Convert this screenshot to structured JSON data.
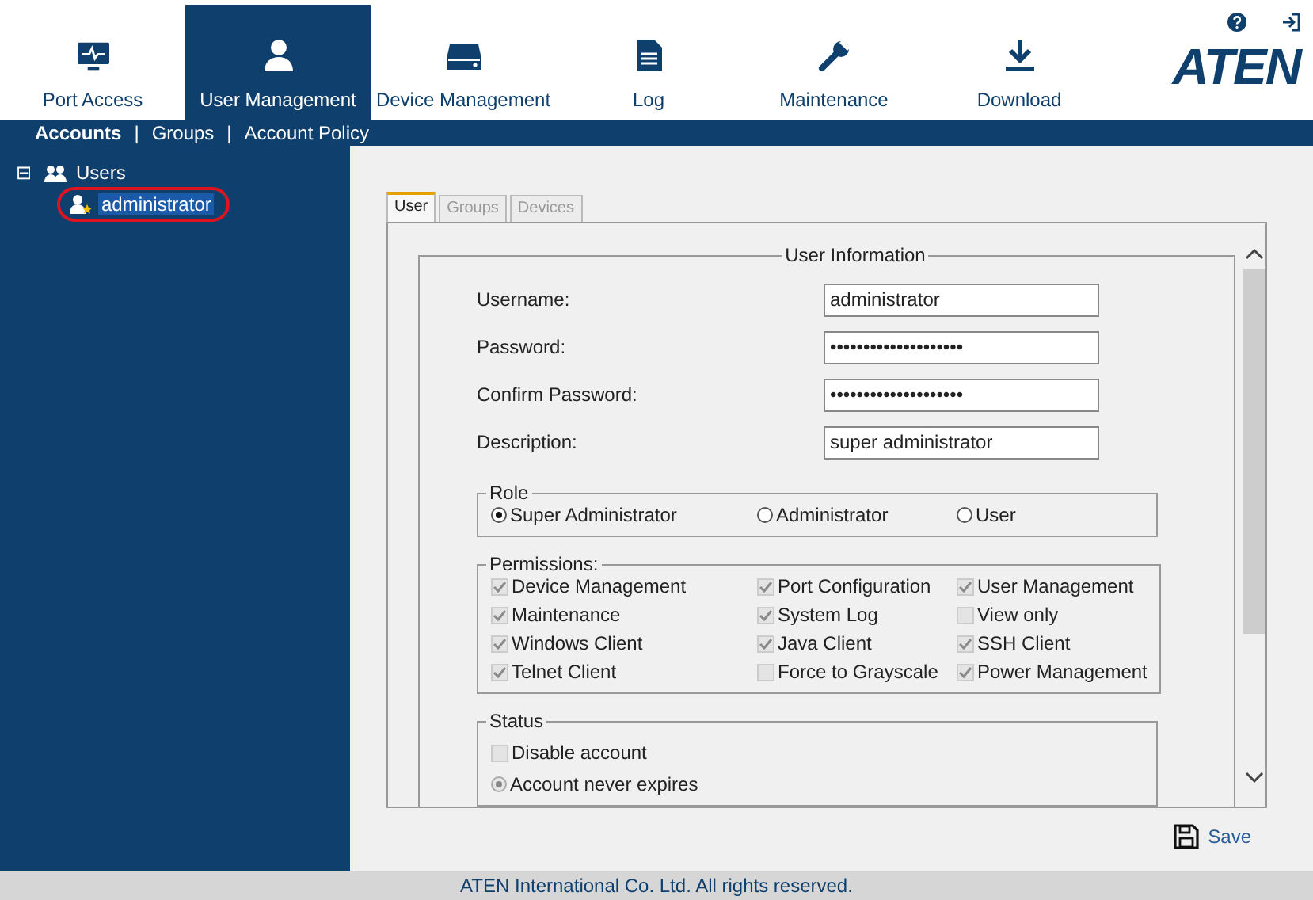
{
  "nav": {
    "tabs": [
      {
        "label": "Port Access",
        "selected": false
      },
      {
        "label": "User Management",
        "selected": true
      },
      {
        "label": "Device Management",
        "selected": false
      },
      {
        "label": "Log",
        "selected": false
      },
      {
        "label": "Maintenance",
        "selected": false
      },
      {
        "label": "Download",
        "selected": false
      }
    ],
    "logo": "ATEN"
  },
  "subnav": [
    {
      "label": "Accounts",
      "selected": true
    },
    {
      "label": "Groups",
      "selected": false
    },
    {
      "label": "Account Policy",
      "selected": false
    }
  ],
  "subnav_separator": "|",
  "tree": {
    "expander": "⊟",
    "label": "Users",
    "expanded": true,
    "children": [
      {
        "label": "administrator",
        "selected": true,
        "highlighted": true
      }
    ]
  },
  "panel_tabs": [
    {
      "label": "User",
      "selected": true
    },
    {
      "label": "Groups",
      "selected": false
    },
    {
      "label": "Devices",
      "selected": false
    }
  ],
  "user_information": {
    "title": "User Information",
    "fields": [
      {
        "label": "Username:",
        "value": "administrator"
      },
      {
        "label": "Password:",
        "value": "••••••••••••••••••••"
      },
      {
        "label": "Confirm Password:",
        "value": "••••••••••••••••••••"
      },
      {
        "label": "Description:",
        "value": "super administrator"
      }
    ]
  },
  "role": {
    "title": "Role",
    "options": [
      {
        "label": "Super Administrator",
        "selected": true
      },
      {
        "label": "Administrator",
        "selected": false
      },
      {
        "label": "User",
        "selected": false
      }
    ]
  },
  "permissions": {
    "title": "Permissions:",
    "items": [
      {
        "label": "Device Management",
        "checked": true
      },
      {
        "label": "Port Configuration",
        "checked": true
      },
      {
        "label": "User Management",
        "checked": true
      },
      {
        "label": "Maintenance",
        "checked": true
      },
      {
        "label": "System Log",
        "checked": true
      },
      {
        "label": "View only",
        "checked": false
      },
      {
        "label": "Windows Client",
        "checked": true
      },
      {
        "label": "Java Client",
        "checked": true
      },
      {
        "label": "SSH Client",
        "checked": true
      },
      {
        "label": "Telnet Client",
        "checked": true
      },
      {
        "label": "Force to Grayscale",
        "checked": false
      },
      {
        "label": "Power Management",
        "checked": true
      }
    ]
  },
  "status": {
    "title": "Status",
    "items": [
      {
        "kind": "checkbox",
        "label": "Disable account",
        "checked": false
      },
      {
        "kind": "radio",
        "label": "Account never expires",
        "checked": true
      }
    ]
  },
  "save_button": "Save",
  "footer": "ATEN International Co. Ltd. All rights reserved."
}
